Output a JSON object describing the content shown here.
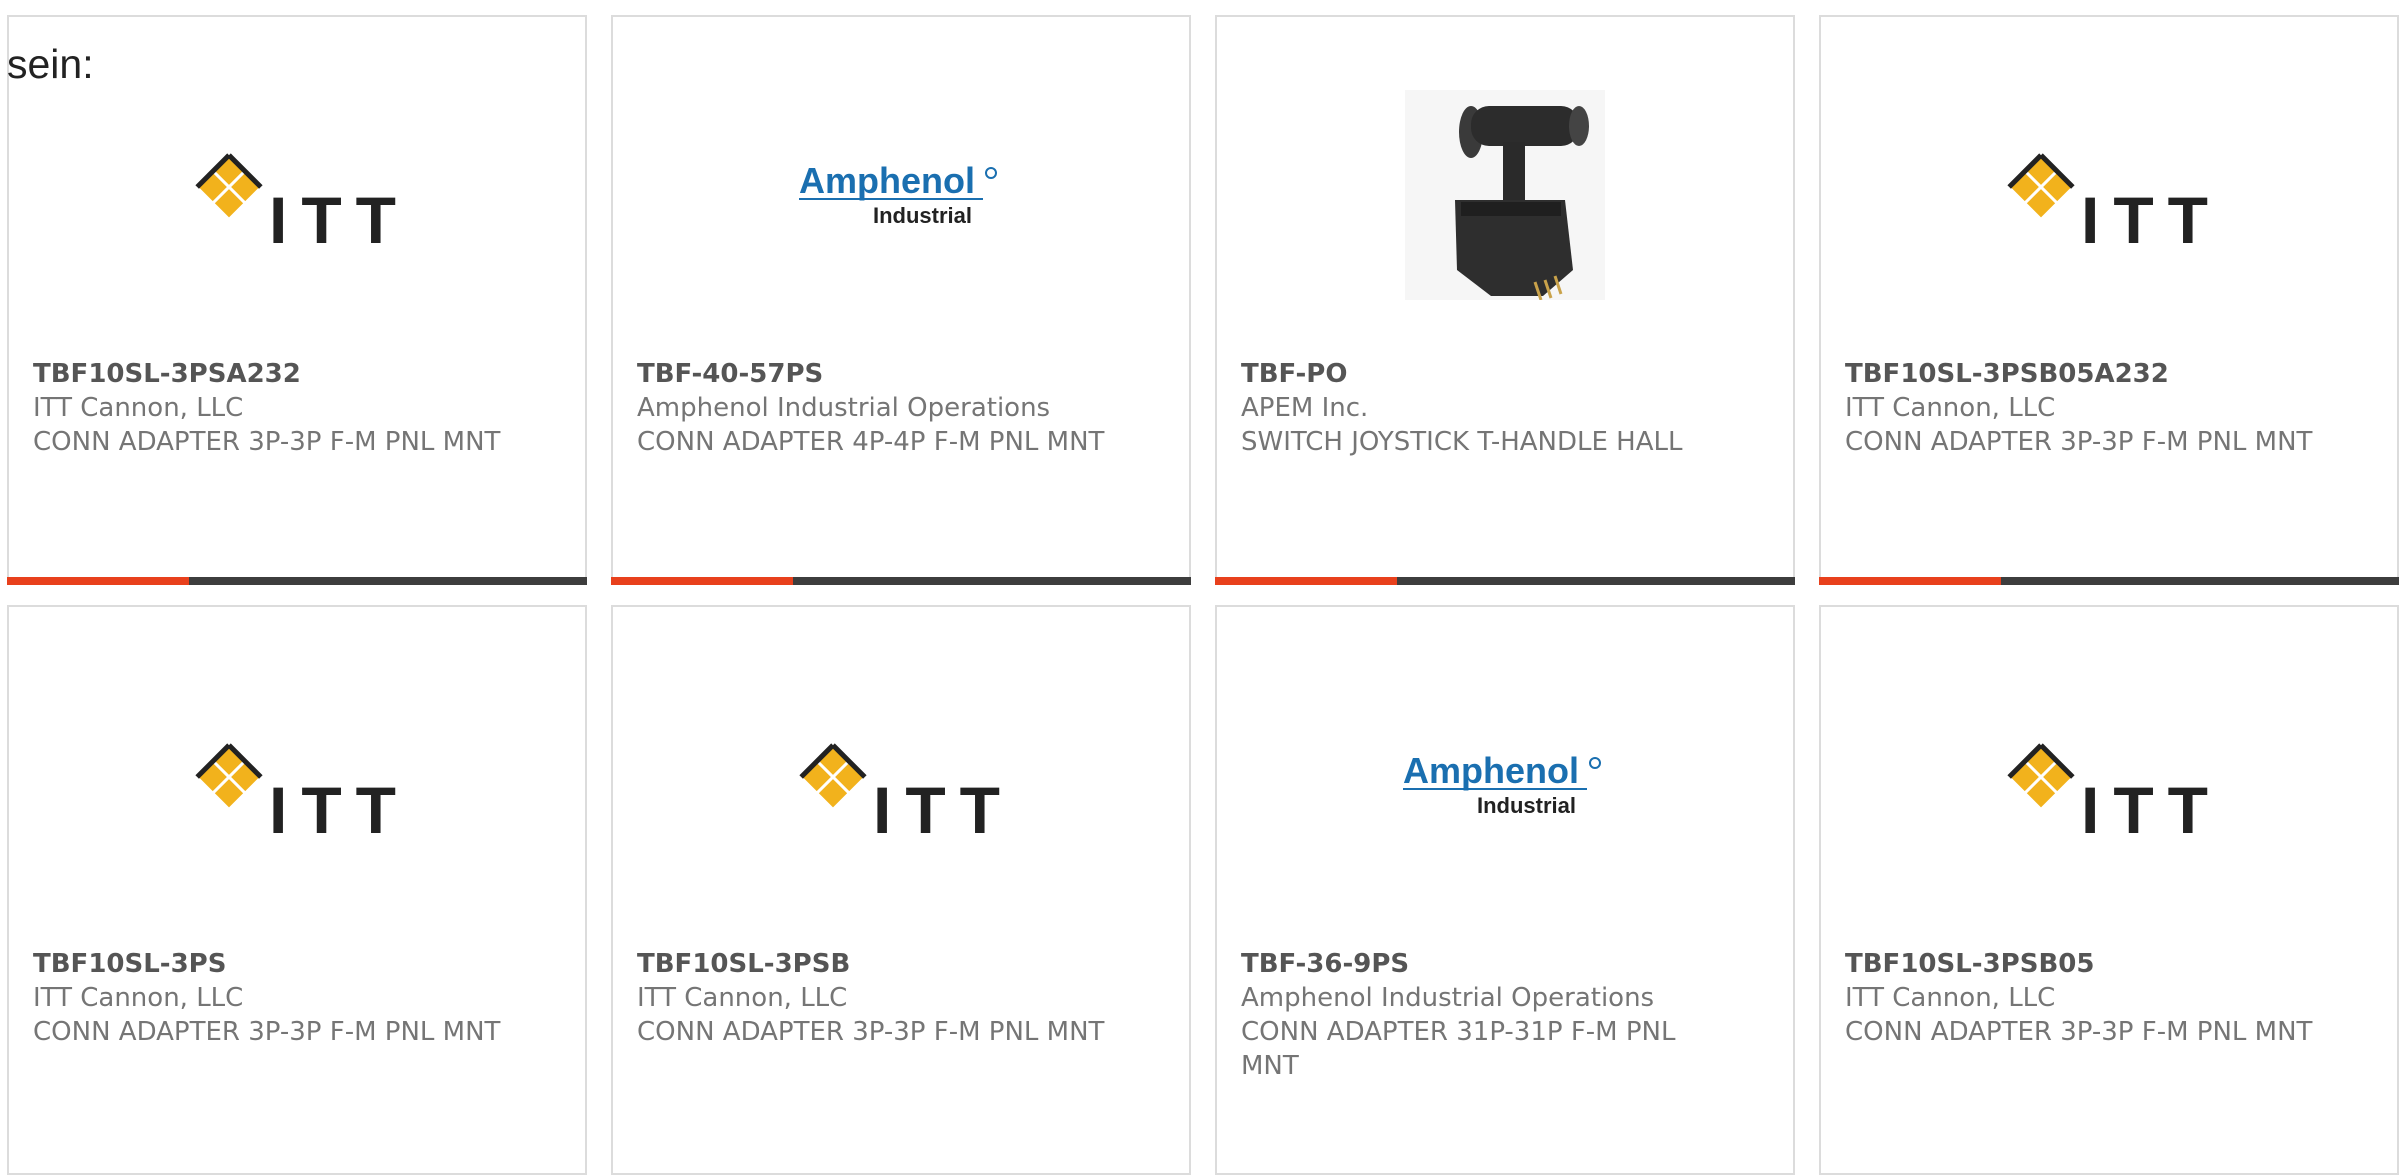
{
  "page_label": "sein:",
  "colors": {
    "accent": "#e8401c",
    "bar": "#3d3d3d",
    "itt_logo": "#f2b21c",
    "amphenol_blue": "#1a6fb0"
  },
  "cards": [
    {
      "part_number": "TBF10SL-3PSA232",
      "manufacturer": "ITT Cannon, LLC",
      "description": "CONN ADAPTER 3P-3P F-M PNL MNT",
      "image": "itt-logo",
      "logo": {
        "text": "ITT"
      }
    },
    {
      "part_number": "TBF-40-57PS",
      "manufacturer": "Amphenol Industrial Operations",
      "description": "CONN ADAPTER 4P-4P F-M PNL MNT",
      "image": "amphenol-logo",
      "logo": {
        "text": "Amphenol",
        "sub": "Industrial"
      }
    },
    {
      "part_number": "TBF-PO",
      "manufacturer": "APEM Inc.",
      "description": "SWITCH JOYSTICK T-HANDLE HALL",
      "image": "joystick-photo",
      "logo": {}
    },
    {
      "part_number": "TBF10SL-3PSB05A232",
      "manufacturer": "ITT Cannon, LLC",
      "description": "CONN ADAPTER 3P-3P F-M PNL MNT",
      "image": "itt-logo",
      "logo": {
        "text": "ITT"
      }
    },
    {
      "part_number": "TBF10SL-3PS",
      "manufacturer": "ITT Cannon, LLC",
      "description": "CONN ADAPTER 3P-3P F-M PNL MNT",
      "image": "itt-logo",
      "logo": {
        "text": "ITT"
      }
    },
    {
      "part_number": "TBF10SL-3PSB",
      "manufacturer": "ITT Cannon, LLC",
      "description": "CONN ADAPTER 3P-3P F-M PNL MNT",
      "image": "itt-logo",
      "logo": {
        "text": "ITT"
      }
    },
    {
      "part_number": "TBF-36-9PS",
      "manufacturer": "Amphenol Industrial Operations",
      "description": "CONN ADAPTER 31P-31P F-M PNL MNT",
      "image": "amphenol-logo",
      "logo": {
        "text": "Amphenol",
        "sub": "Industrial"
      }
    },
    {
      "part_number": "TBF10SL-3PSB05",
      "manufacturer": "ITT Cannon, LLC",
      "description": "CONN ADAPTER 3P-3P F-M PNL MNT",
      "image": "itt-logo",
      "logo": {
        "text": "ITT"
      }
    }
  ]
}
